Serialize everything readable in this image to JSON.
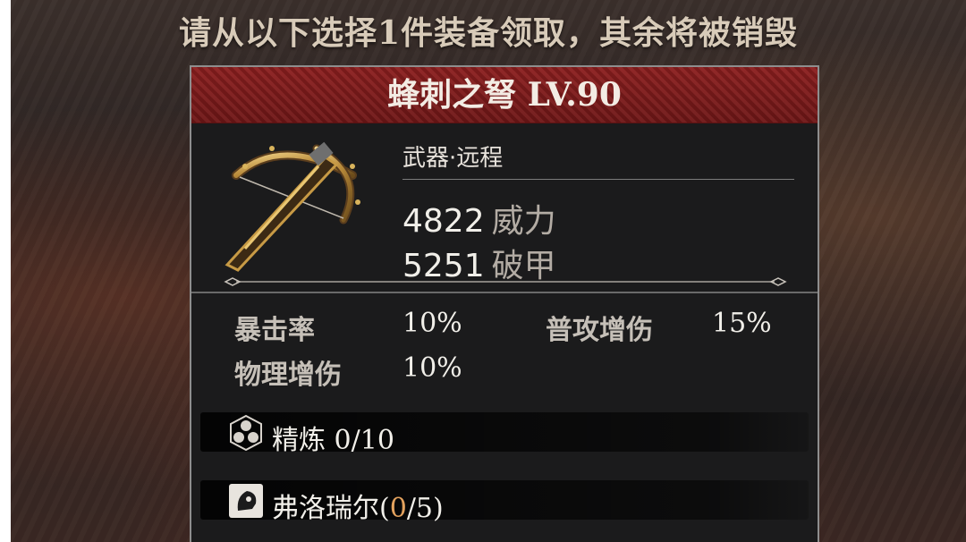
{
  "headline": "请从以下选择1件装备领取，其余将被销毁",
  "item": {
    "name": "蜂刺之弩 LV.90",
    "category": "武器·远程",
    "main_stats": [
      {
        "value": "4822",
        "label": "威力"
      },
      {
        "value": "5251",
        "label": "破甲"
      }
    ],
    "sub_stats": [
      {
        "label": "暴击率",
        "value": "10%"
      },
      {
        "label": "普攻增伤",
        "value": "15%"
      },
      {
        "label": "物理增伤",
        "value": "10%"
      }
    ],
    "refine": {
      "label": "精炼",
      "value": "0/10"
    },
    "set": {
      "name": "弗洛瑞尔",
      "open": "(",
      "current": "0",
      "rest": "/5)"
    }
  },
  "colors": {
    "title_bar": "#8c1f1f",
    "panel_bg": "#1b1b1c",
    "accent_orange": "#e3a25e"
  },
  "icons": [
    "crossbow-icon",
    "refine-hex-icon",
    "set-portrait-icon",
    "divider-ornament-icon"
  ]
}
